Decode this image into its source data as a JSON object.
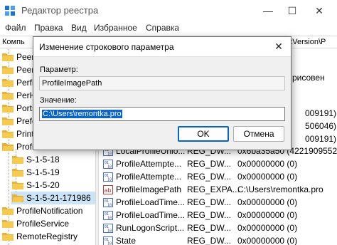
{
  "window": {
    "title": "Редактор реестра",
    "controls": {
      "minimize": "—",
      "maximize": "☐",
      "close": "✕"
    }
  },
  "menu": [
    "Файл",
    "Правка",
    "Вид",
    "Избранное",
    "Справка"
  ],
  "address": {
    "left": "Компь",
    "right": "entVersion\\P"
  },
  "tree": {
    "items": [
      "PeerD",
      "PeerN",
      "Perflii",
      "PerHw",
      "Ports",
      "Prefet",
      "Print",
      "Profile",
      "S-1-5-18",
      "S-1-5-19",
      "S-1-5-20",
      "S-1-5-21-171986",
      "ProfileNotification",
      "ProfileService",
      "RemoteRegistry"
    ]
  },
  "values_pane": {
    "partial_right": [
      "рисовен",
      "009191)",
      "506046)",
      "009191)"
    ],
    "rows": [
      {
        "name": "LocalProfileUnlo...",
        "type": "REG_DW...",
        "data": "0x6ba35a50 (4221909552"
      },
      {
        "name": "ProfileAttempte...",
        "type": "REG_DW...",
        "data": "0x00000000 (0)"
      },
      {
        "name": "ProfileAttempte...",
        "type": "REG_DW...",
        "data": "0x00000000 (0)"
      },
      {
        "name": "ProfileImagePath",
        "type": "REG_EXPA...",
        "data": "C:\\Users\\remontka.pro"
      },
      {
        "name": "ProfileLoadTime...",
        "type": "REG_DW...",
        "data": "0x00000000 (0)"
      },
      {
        "name": "ProfileLoadTime...",
        "type": "REG_DW...",
        "data": "0x00000000 (0)"
      },
      {
        "name": "RunLogonScript...",
        "type": "REG_DW...",
        "data": "0x00000000 (0)"
      },
      {
        "name": "State",
        "type": "REG_DW...",
        "data": "0x00000000 (0)"
      }
    ]
  },
  "dialog": {
    "title": "Изменение строкового параметра",
    "close": "✕",
    "param_label": "Параметр:",
    "param_value": "ProfileImagePath",
    "value_label": "Значение:",
    "value_value": "C:\\Users\\remontka.pro",
    "ok": "OK",
    "cancel": "Отмена"
  },
  "colors": {
    "accent": "#0a64c8",
    "selection": "#cce4f7",
    "folder": "#e8b23a"
  }
}
